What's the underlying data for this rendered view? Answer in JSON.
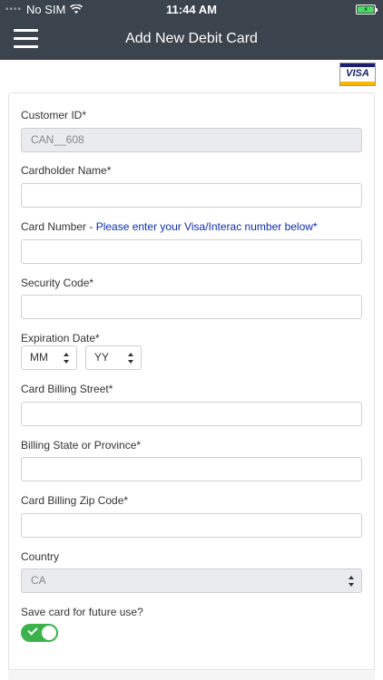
{
  "status": {
    "carrier": "No SIM",
    "time": "11:44 AM"
  },
  "header": {
    "title": "Add New Debit Card"
  },
  "brand": {
    "visa_label": "VISA"
  },
  "form": {
    "customer_id_label": "Customer ID*",
    "customer_id_value": "CAN__608",
    "cardholder_label": "Cardholder Name*",
    "card_number_label": "Card Number - ",
    "card_number_note": "Please enter your Visa/Interac number below*",
    "security_code_label": "Security Code*",
    "expiration_label": "Expiration Date*",
    "month_value": "MM",
    "year_value": "YY",
    "billing_street_label": "Card Billing Street*",
    "billing_state_label": "Billing State or Province*",
    "billing_zip_label": "Card Billing Zip Code*",
    "country_label": "Country",
    "country_value": "CA",
    "save_card_label": "Save card for future use?",
    "save_card_on": true
  }
}
